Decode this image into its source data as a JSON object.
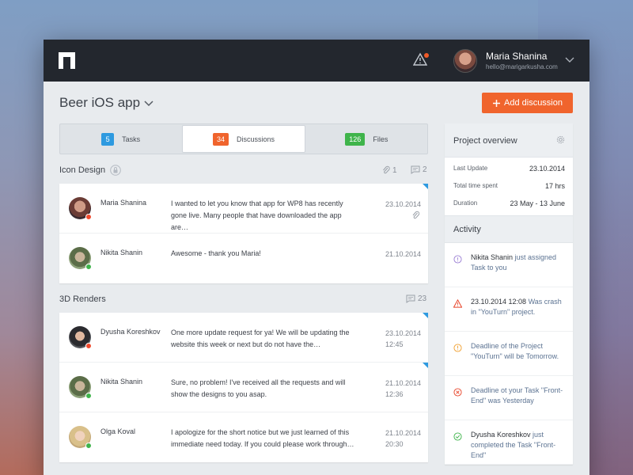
{
  "user": {
    "name": "Maria Shanina",
    "email": "hello@marigarkusha.com"
  },
  "project": {
    "title": "Beer iOS app",
    "add_label": "Add discussion"
  },
  "tabs": [
    {
      "count": "5",
      "label": "Tasks"
    },
    {
      "count": "34",
      "label": "Discussions"
    },
    {
      "count": "126",
      "label": "Files"
    }
  ],
  "sections": [
    {
      "title": "Icon Design",
      "attachments": "1",
      "comments": "2",
      "rows": [
        {
          "name": "Maria Shanina",
          "message": "I wanted to let you know that app for WP8 has recently gone live. Many people that have downloaded the app are…",
          "date": "23.10.2014",
          "time": ""
        },
        {
          "name": "Nikita Shanin",
          "message": "Awesome - thank you Maria!",
          "date": "21.10.2014",
          "time": ""
        }
      ]
    },
    {
      "title": "3D Renders",
      "comments": "23",
      "rows": [
        {
          "name": "Dyusha Koreshkov",
          "message": "One more update request for ya! We will be updating the website this week or next but do not have the…",
          "date": "23.10.2014",
          "time": "12:45"
        },
        {
          "name": "Nikita Shanin",
          "message": "Sure, no problem! I've received all the requests and will show the designs to you asap.",
          "date": "21.10.2014",
          "time": "12:36"
        },
        {
          "name": "Olga Koval",
          "message": "I apologize for the short notice but we just learned of this immediate need today. If you could please work through…",
          "date": "21.10.2014",
          "time": "20:30"
        }
      ]
    }
  ],
  "overview": {
    "title": "Project overview",
    "items": [
      {
        "label": "Last Update",
        "value": "23.10.2014"
      },
      {
        "label": "Total time spent",
        "value": "17 hrs"
      },
      {
        "label": "Duration",
        "value": "23 May - 13 June"
      }
    ]
  },
  "activity": {
    "title": "Activity",
    "items": [
      {
        "icon": "info-icon",
        "color": "#9b7fd4",
        "strong": "Nikita Shanin",
        "text": " just assigned Task to you"
      },
      {
        "icon": "warning-icon",
        "color": "#e8452a",
        "strong": "23.10.2014 12:08",
        "text": " Was crash in \"YouTurn\" project."
      },
      {
        "icon": "alert-icon",
        "color": "#f0a030",
        "strong": "",
        "text": "Deadline of the Project \"YouTurn\" will be Tomorrow."
      },
      {
        "icon": "error-icon",
        "color": "#e8452a",
        "strong": "",
        "text": "Deadline ot your Task \"Front-End\" was Yesterday"
      },
      {
        "icon": "check-icon",
        "color": "#3fb44b",
        "strong": "Dyusha Koreshkov",
        "text": " just completed the Task \"Front-End\""
      }
    ]
  }
}
